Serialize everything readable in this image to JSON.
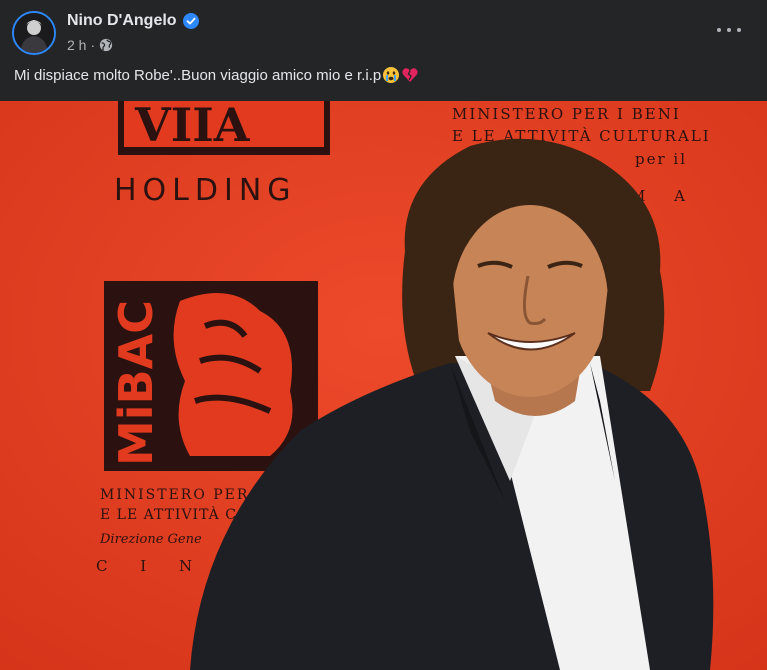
{
  "post": {
    "author": "Nino D'Angelo",
    "verified_icon": "verified-badge-icon",
    "timestamp": "2 h",
    "separator": "·",
    "audience_icon": "globe-icon",
    "more_icon": "more-options-icon",
    "caption": "Mi dispiace molto Robe'..Buon viaggio amico mio e r.i.p",
    "caption_emojis": [
      "crying-face-icon",
      "broken-heart-icon"
    ]
  },
  "photo": {
    "backdrop": {
      "logo_top": "HOLDING",
      "logo_side": "MiBAC",
      "ministry_top_lines": [
        "MINISTERO PER I BENI",
        "E LE ATTIVITÀ CULTURALI",
        "per il",
        "M A"
      ],
      "ministry_bottom_lines": [
        "MINISTERO PER",
        "E LE ATTIVITÀ C",
        "Direzione Gene",
        "C I N"
      ]
    }
  },
  "colors": {
    "background": "#242526",
    "text_primary": "#e4e6eb",
    "text_secondary": "#b0b3b8",
    "verified_blue": "#2d88ff",
    "photo_backdrop": "#e13a1f"
  }
}
